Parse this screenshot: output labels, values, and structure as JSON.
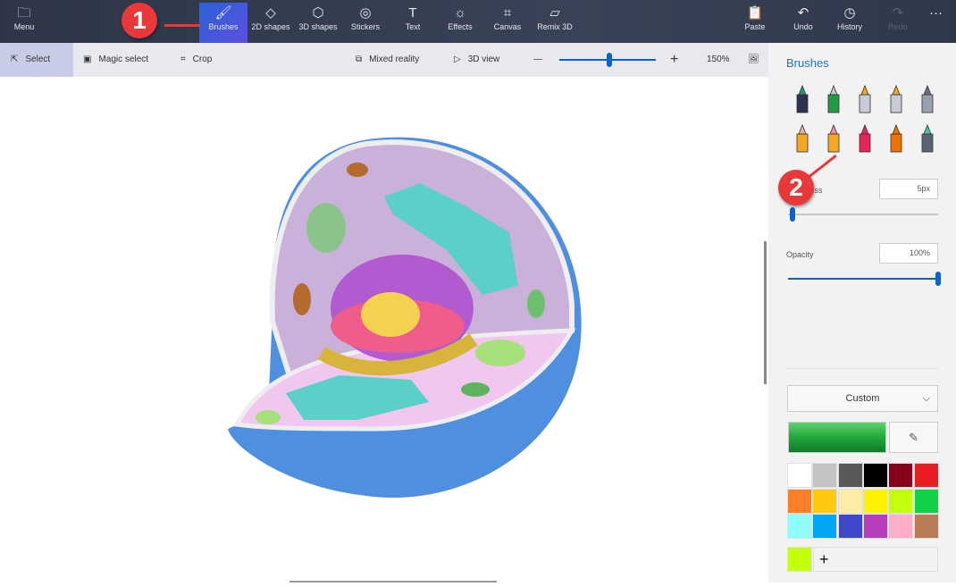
{
  "topbar": {
    "items": [
      {
        "label": "Menu",
        "icon": "folder-icon"
      },
      {
        "label": "Brushes",
        "icon": "brush-icon",
        "active": true
      },
      {
        "label": "2D shapes",
        "icon": "2d-shapes-icon"
      },
      {
        "label": "3D shapes",
        "icon": "cube-icon"
      },
      {
        "label": "Stickers",
        "icon": "sticker-icon"
      },
      {
        "label": "Text",
        "icon": "text-icon"
      },
      {
        "label": "Effects",
        "icon": "sun-icon"
      },
      {
        "label": "Canvas",
        "icon": "canvas-icon"
      },
      {
        "label": "Remix 3D",
        "icon": "remix-icon"
      },
      {
        "label": "Paste",
        "icon": "clipboard-icon"
      },
      {
        "label": "Undo",
        "icon": "undo-icon"
      },
      {
        "label": "History",
        "icon": "history-icon"
      },
      {
        "label": "Redo",
        "icon": "redo-icon",
        "disabled": true
      }
    ],
    "more": "···"
  },
  "toolbar": {
    "select": "Select",
    "magic_select": "Magic select",
    "crop": "Crop",
    "mixed_reality": "Mixed reality",
    "view3d": "3D view",
    "zoom_minus": "—",
    "zoom_plus": "+",
    "zoom": "150%",
    "zoom_level_fraction": 0.52
  },
  "panel": {
    "title": "Brushes",
    "brushes": [
      "marker",
      "calligraphy-pen",
      "oil-brush",
      "watercolor",
      "pixel-pen",
      "pencil",
      "eraser",
      "crayon",
      "spray-can",
      "fill"
    ],
    "thickness_label": "Thickness",
    "thickness": "5px",
    "thickness_fraction": 0.03,
    "opacity_label": "Opacity",
    "opacity": "100%",
    "opacity_fraction": 1.0,
    "color_mode": "Custom",
    "current_color": "#22a83a",
    "palette": [
      "#ffffff",
      "#c3c3c3",
      "#585858",
      "#000000",
      "#88001b",
      "#ec1c24",
      "#ff7f27",
      "#ffc90e",
      "#fdeca6",
      "#fff200",
      "#c4ff0e",
      "#0ed145",
      "#8cfffb",
      "#00a8f3",
      "#3f48cc",
      "#b83dba",
      "#ffaec8",
      "#b97a56"
    ],
    "custom_color": "#c4ff0e",
    "add": "+"
  },
  "annotations": [
    "1",
    "2"
  ]
}
